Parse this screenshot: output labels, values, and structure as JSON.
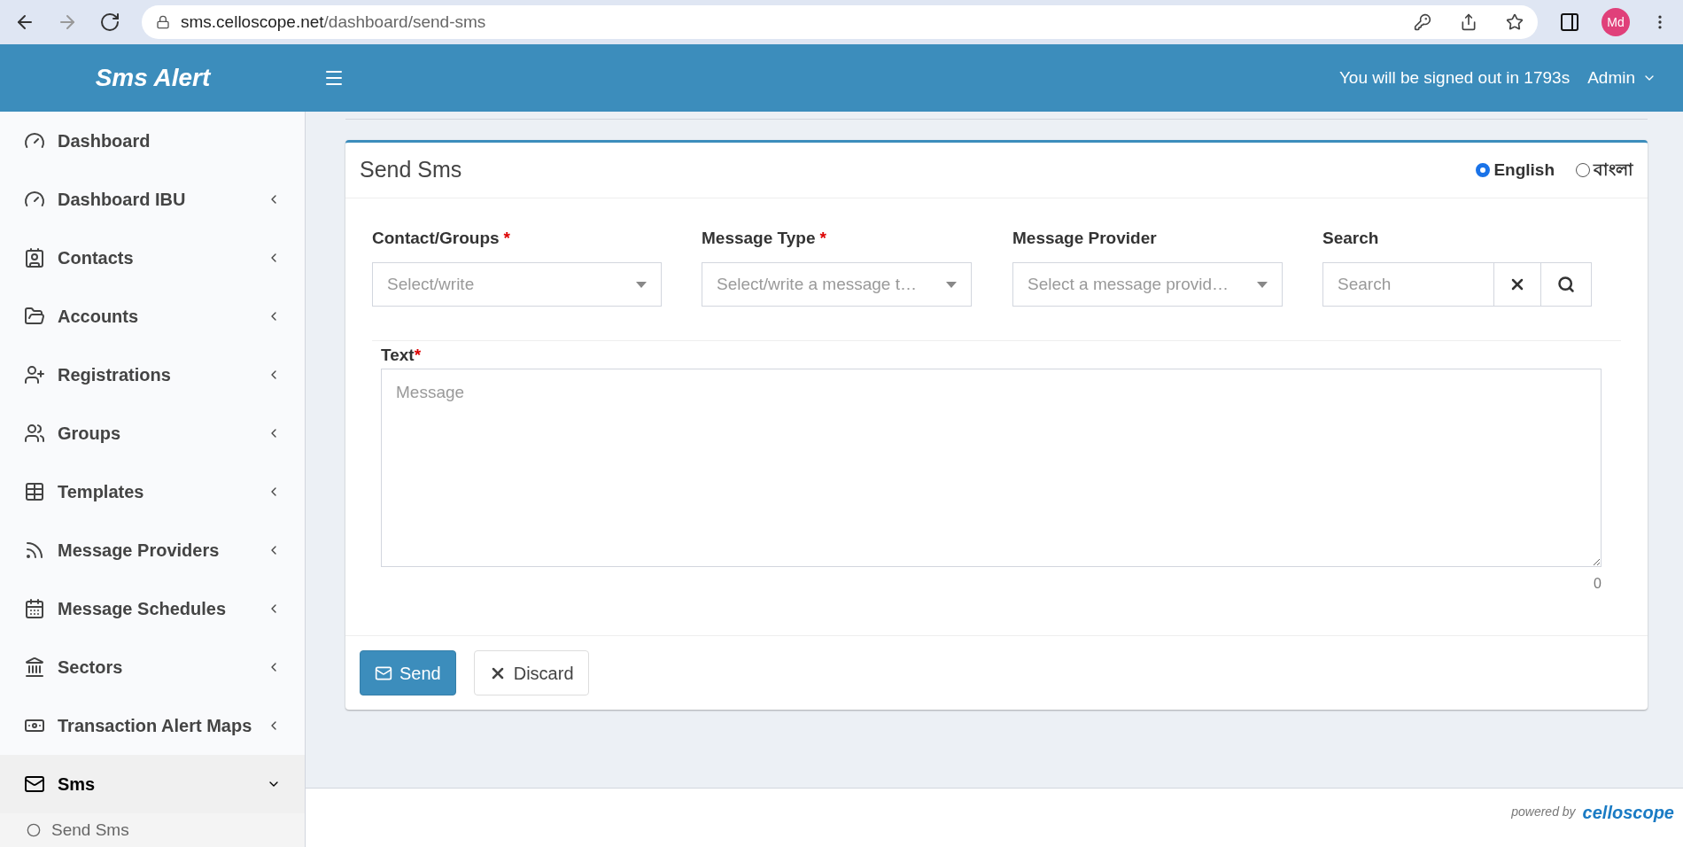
{
  "browser": {
    "url_host": "sms.celloscope.net",
    "url_path": "/dashboard/send-sms",
    "avatar": "Md"
  },
  "header": {
    "brand": "Sms Alert",
    "session_notice": "You will be signed out in 1793s",
    "user": "Admin"
  },
  "sidebar": {
    "items": [
      {
        "label": "Dashboard",
        "selected": false
      },
      {
        "label": "Dashboard IBU",
        "expandable": true,
        "expanded": false,
        "selected": false
      },
      {
        "label": "Contacts",
        "expandable": true,
        "expanded": false,
        "selected": false
      },
      {
        "label": "Accounts",
        "expandable": true,
        "expanded": false,
        "selected": false
      },
      {
        "label": "Registrations",
        "expandable": true,
        "expanded": false,
        "selected": false
      },
      {
        "label": "Groups",
        "expandable": true,
        "expanded": false,
        "selected": false
      },
      {
        "label": "Templates",
        "expandable": true,
        "expanded": false,
        "selected": false
      },
      {
        "label": "Message Providers",
        "expandable": true,
        "expanded": false,
        "selected": false
      },
      {
        "label": "Message Schedules",
        "expandable": true,
        "expanded": false,
        "selected": false
      },
      {
        "label": "Sectors",
        "expandable": true,
        "expanded": false,
        "selected": false
      },
      {
        "label": "Transaction Alert Maps",
        "expandable": true,
        "expanded": false,
        "selected": false
      },
      {
        "label": "Sms",
        "expandable": true,
        "expanded": true,
        "selected": true,
        "children": [
          {
            "label": "Send Sms",
            "selected": false
          }
        ]
      }
    ]
  },
  "card": {
    "title": "Send Sms",
    "languages": [
      {
        "label": "English",
        "selected": true
      },
      {
        "label": "বাংলা",
        "selected": false
      }
    ],
    "fields": [
      {
        "label": "Contact/Groups",
        "required_mark": "*",
        "kind": "select",
        "placeholder": "Select/write"
      },
      {
        "label": "Message Type",
        "required_mark": "*",
        "kind": "select",
        "placeholder": "Select/write a message t…"
      },
      {
        "label": "Message Provider",
        "kind": "select",
        "placeholder": "Select a message provid…"
      },
      {
        "label": "Search",
        "kind": "search",
        "placeholder": "Search"
      }
    ],
    "text": {
      "label": "Text",
      "required_mark": "*",
      "placeholder": "Message",
      "count": "0"
    },
    "buttons": [
      {
        "label": "Send",
        "kind": "primary"
      },
      {
        "label": "Discard",
        "kind": "default"
      }
    ]
  },
  "footer": {
    "powered_by": "powered by",
    "brand": "celloscope"
  }
}
